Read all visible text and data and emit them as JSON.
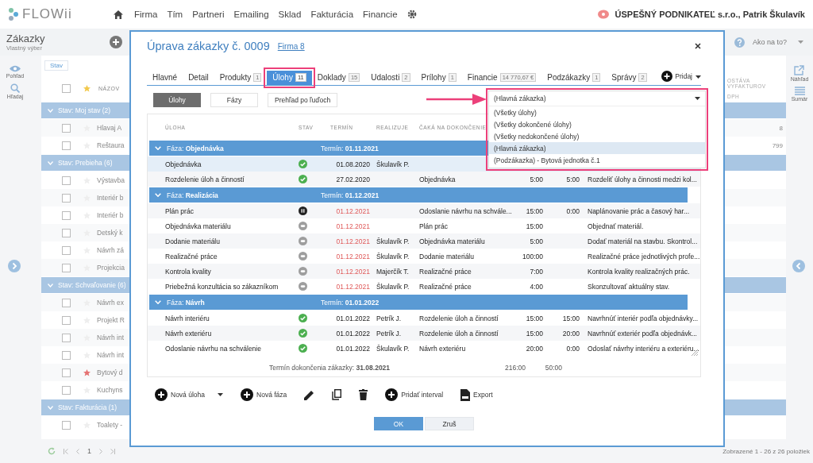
{
  "app_bar": {
    "logo": "FLOWii",
    "nav": [
      "Firma",
      "Tím",
      "Partneri",
      "Emailing",
      "Sklad",
      "Fakturácia",
      "Financie"
    ],
    "company": "ÚSPEŠNÝ PODNIKATEĽ s.r.o., Patrik Škulavík"
  },
  "page": {
    "title": "Zákazky",
    "subtitle": "Vlastný výber",
    "help": "Ako na to?",
    "filter_chip": "Stav",
    "column_name": "NÁZOV",
    "select_all_checked": false,
    "column_right": "OSTÁVA VYFAKTUROV",
    "column_right_sub": "DPH",
    "groups": [
      {
        "label": "Stav: Moj stav (2)",
        "expanded": true,
        "rows": [
          {
            "name": "Hlavaj A",
            "checked": false,
            "starred": false,
            "value": "8"
          },
          {
            "name": "Reštaura",
            "checked": false,
            "starred": false,
            "value": "799"
          }
        ]
      },
      {
        "label": "Stav: Prebieha (6)",
        "expanded": true,
        "rows": [
          {
            "name": "Výstavba",
            "checked": false,
            "starred": false
          },
          {
            "name": "Interiér b",
            "checked": false,
            "starred": false
          },
          {
            "name": "Interiér b",
            "checked": false,
            "starred": false
          },
          {
            "name": "Detský k",
            "checked": false,
            "starred": false
          },
          {
            "name": "Návrh zá",
            "checked": false,
            "starred": false
          },
          {
            "name": "Projekcia",
            "checked": false,
            "starred": false
          }
        ]
      },
      {
        "label": "Stav: Schvaľovanie (6)",
        "expanded": true,
        "rows": [
          {
            "name": "Návrh ex",
            "checked": false,
            "starred": false
          },
          {
            "name": "Projekt R",
            "checked": false,
            "starred": false
          },
          {
            "name": "Návrh int",
            "checked": false,
            "starred": false
          },
          {
            "name": "Návrh int",
            "checked": false,
            "starred": false
          },
          {
            "name": "Bytový d",
            "checked": false,
            "starred": true
          },
          {
            "name": "Kuchyns",
            "checked": false,
            "starred": false
          }
        ]
      },
      {
        "label": "Stav: Fakturácia (1)",
        "expanded": true,
        "rows": [
          {
            "name": "Toalety -",
            "checked": false,
            "starred": false
          }
        ]
      }
    ],
    "pagination": {
      "page": "1",
      "summary": "Zobrazené 1 - 26 z 26 položiek"
    }
  },
  "left_rail": [
    {
      "label": "Pohľad",
      "kind": "view"
    },
    {
      "label": "Hľadaj",
      "kind": "search"
    }
  ],
  "right_rail": [
    {
      "label": "Náhľad",
      "kind": "preview"
    },
    {
      "label": "Sumár",
      "kind": "summary"
    }
  ],
  "dialog": {
    "title": "Úprava zákazky č. 0009",
    "link": "Firma 8",
    "tabs": [
      {
        "label": "Hlavné",
        "selected": false
      },
      {
        "label": "Detail",
        "selected": false
      },
      {
        "label": "Produkty",
        "badge": "1",
        "selected": false
      },
      {
        "label": "Úlohy",
        "badge": "11",
        "selected": true
      },
      {
        "label": "Doklady",
        "badge": "15",
        "selected": false
      },
      {
        "label": "Udalosti",
        "badge": "2",
        "selected": false
      },
      {
        "label": "Prílohy",
        "badge": "1",
        "selected": false
      },
      {
        "label": "Financie",
        "badge": "14 770,67 €",
        "selected": false
      },
      {
        "label": "Podzákazky",
        "badge": "1",
        "selected": false
      },
      {
        "label": "Správy",
        "badge": "2",
        "selected": false
      }
    ],
    "add_button": "Pridaj",
    "views": [
      {
        "label": "Úlohy",
        "selected": true
      },
      {
        "label": "Fázy",
        "selected": false
      },
      {
        "label": "Prehľad po ľuďoch",
        "selected": false
      }
    ],
    "filter": {
      "value": "(Hlavná zákazka)",
      "options": [
        {
          "label": "(Všetky úlohy)",
          "selected": false
        },
        {
          "label": "(Všetky dokončené úlohy)",
          "selected": false
        },
        {
          "label": "(Všetky nedokončené úlohy)",
          "selected": false
        },
        {
          "label": "(Hlavná zákazka)",
          "selected": true
        },
        {
          "label": "(Podzákazka) - Bytová jednotka č.1",
          "selected": false
        }
      ]
    },
    "columns": [
      "ÚLOHA",
      "STAV",
      "TERMÍN",
      "REALIZUJE",
      "ČAKÁ NA DOKONČENIE"
    ],
    "phases": [
      {
        "label": "Fáza: **Objednávka**",
        "deadline": "Termín: **01.11.2021**",
        "expanded": true,
        "rows": [
          {
            "task": "Objednávka",
            "kind": "done",
            "due": "01.08.2020",
            "late": false,
            "assignee": "Škulavík P.",
            "selected": true
          },
          {
            "task": "Rozdelenie úloh a činností",
            "kind": "done",
            "due": "27.02.2020",
            "late": false,
            "waits_on": "Objednávka",
            "time_1": "5:00",
            "time_2": "5:00",
            "description": "Rozdeliť úlohy a činnosti medzi kol...",
            "selected": false
          }
        ]
      },
      {
        "label": "Fáza: **Realizácia**",
        "deadline": "Termín: **01.12.2021**",
        "expanded": true,
        "rows": [
          {
            "task": "Plán prác",
            "kind": "paused",
            "due": "01.12.2021",
            "late": true,
            "waits_on": "Odoslanie návrhu na schvále...",
            "time_1": "15:00",
            "time_2": "0:00",
            "description": "Naplánovanie prác a časový har...",
            "selected": false
          },
          {
            "task": "Objednávka materiálu",
            "kind": "waiting",
            "due": "01.12.2021",
            "late": true,
            "waits_on": "Plán prác",
            "time_1": "15:00",
            "description": "Objednať materiál.",
            "selected": false
          },
          {
            "task": "Dodanie materiálu",
            "kind": "waiting",
            "due": "01.12.2021",
            "late": true,
            "assignee": "Škulavík P.",
            "waits_on": "Objednávka materiálu",
            "time_1": "5:00",
            "description": "Dodať materiál na stavbu. Skontrol...",
            "selected": false
          },
          {
            "task": "Realizačné práce",
            "kind": "waiting",
            "due": "01.12.2021",
            "late": true,
            "assignee": "Škulavík P.",
            "waits_on": "Dodanie materiálu",
            "time_1": "100:00",
            "description": "Realizačné práce jednotlivých profe...",
            "selected": false
          },
          {
            "task": "Kontrola kvality",
            "kind": "waiting",
            "due": "01.12.2021",
            "late": true,
            "assignee": "Majerčík T.",
            "waits_on": "Realizačné práce",
            "time_1": "7:00",
            "description": "Kontrola kvality realizačných prác.",
            "selected": false
          },
          {
            "task": "Priebežná konzultácia so zákazníkom",
            "kind": "waiting",
            "due": "01.12.2021",
            "late": true,
            "assignee": "Škulavík P.",
            "waits_on": "Realizačné práce",
            "time_1": "4:00",
            "description": "Skonzultovať aktuálny stav.",
            "selected": false
          }
        ]
      },
      {
        "label": "Fáza: **Návrh**",
        "deadline": "Termín: **01.01.2022**",
        "expanded": true,
        "rows": [
          {
            "task": "Návrh interiéru",
            "kind": "done",
            "due": "01.01.2022",
            "late": false,
            "assignee": "Petrík J.",
            "waits_on": "Rozdelenie úloh a činností",
            "time_1": "15:00",
            "time_2": "15:00",
            "description": "Navrhnúť interiér podľa objednávky...",
            "selected": false
          },
          {
            "task": "Návrh exteriéru",
            "kind": "done",
            "due": "01.01.2022",
            "late": false,
            "assignee": "Petrík J.",
            "waits_on": "Rozdelenie úloh a činností",
            "time_1": "15:00",
            "time_2": "20:00",
            "description": "Navrhnúť exteriér podľa objednávk...",
            "selected": false
          },
          {
            "task": "Odoslanie návrhu na schválenie",
            "kind": "done",
            "due": "01.01.2022",
            "late": false,
            "assignee": "Škulavík P.",
            "waits_on": "Návrh exteriéru",
            "time_1": "20:00",
            "time_2": "0:00",
            "description": "Odoslať návrhy interiéru a exteriéru...",
            "selected": false
          }
        ]
      }
    ],
    "footer": {
      "deadline": "Termín dokončenia zákazky: **31.08.2021**",
      "total_1": "216:00",
      "total_2": "50:00"
    },
    "toolbar": [
      {
        "kind": "add",
        "label": "Nová úloha",
        "menu": true
      },
      {
        "kind": "add",
        "label": "Nová fáza"
      },
      {
        "kind": "edit"
      },
      {
        "kind": "copy"
      },
      {
        "kind": "delete"
      },
      {
        "kind": "add",
        "label": "Pridať interval"
      },
      {
        "kind": "export",
        "label": "Export"
      }
    ],
    "buttons": [
      {
        "label": "OK",
        "primary": true
      },
      {
        "label": "Zruš",
        "primary": false
      }
    ]
  }
}
